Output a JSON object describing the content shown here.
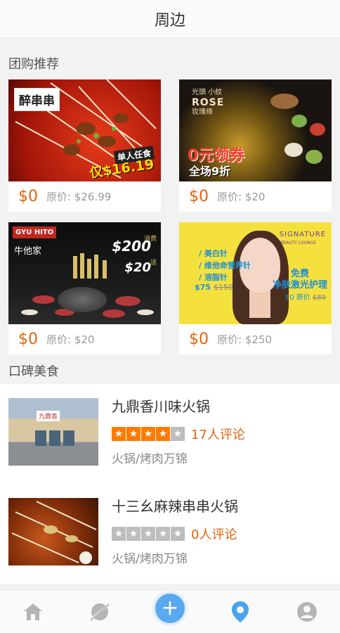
{
  "header": {
    "title": "周边"
  },
  "group_section": {
    "title": "团购推荐"
  },
  "deals": [
    {
      "price": "$0",
      "original": "原价: $26.99",
      "img_logo": "醉串串",
      "img_promo_line1": "单人任食",
      "img_promo_line2": "仅$16.19"
    },
    {
      "price": "$0",
      "original": "原价: $20",
      "img_brand_top": "光頭 小紋",
      "img_brand_name": "ROSE",
      "img_brand_cn": "玫瑰缘",
      "img_promo_line1": "0元领券",
      "img_promo_line2": "全场9折"
    },
    {
      "price": "$0",
      "original": "原价: $20",
      "img_logo": "GYU HITO",
      "img_cn": "牛他家",
      "img_spend_label": "消费",
      "img_spend": "$200",
      "img_get_label": "送",
      "img_get": "$20"
    },
    {
      "price": "$0",
      "original": "原价: $250",
      "img_brand": "SIGNATURE",
      "img_brand_sub": "BEAUTY LOUNGE",
      "img_items": [
        "/ 美白针",
        "/ 维他命营养针",
        "/ 溶脂针"
      ],
      "img_price_now": "$75",
      "img_price_old": "$150",
      "img_free": "免费",
      "img_free_item": "净肤激光护理",
      "img_free_now": "$0",
      "img_free_old_label": "原价",
      "img_free_old": "$89"
    }
  ],
  "reputation_section": {
    "title": "口碑美食"
  },
  "restaurants": [
    {
      "name": "九鼎香川味火锅",
      "rating": 4,
      "reviews": "17人评论",
      "category": "火锅/烤肉万锦",
      "sign": "九鼎香"
    },
    {
      "name": "十三幺麻辣串串火锅",
      "rating": 0,
      "reviews": "0人评论",
      "category": "火锅/烤肉万锦"
    }
  ],
  "tabbar": {
    "items": [
      "home-icon",
      "discover-icon",
      "add-icon",
      "location-icon",
      "profile-icon"
    ],
    "active": "location-icon",
    "add_symbol": "+"
  },
  "colors": {
    "accent": "#e8620a",
    "star_on": "#ff7a00",
    "star_off": "#bdbdbd",
    "fab": "#5aa9f0",
    "tab_active": "#4aa3ef",
    "tab_inactive": "#b5b5b5"
  }
}
